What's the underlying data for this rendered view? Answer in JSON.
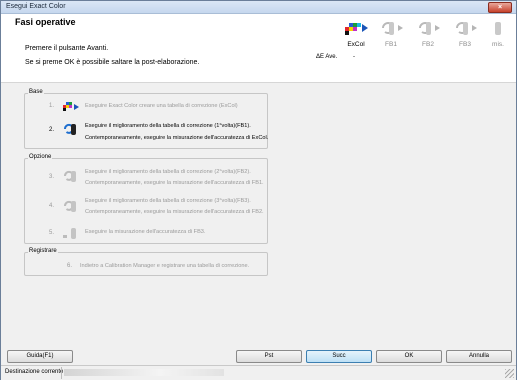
{
  "window": {
    "title": "Esegui Exact Color",
    "close_label": "×"
  },
  "header": {
    "heading": "Fasi operative",
    "line1": "Premere il pulsante Avanti.",
    "line2": "Se si preme OK è possibile saltare la post-elaborazione.",
    "delta_label": "ΔE Ave.",
    "delta_value": "-"
  },
  "steps": [
    {
      "label": "ExCol",
      "active": true
    },
    {
      "label": "FB1",
      "active": false
    },
    {
      "label": "FB2",
      "active": false
    },
    {
      "label": "FB3",
      "active": false
    },
    {
      "label": "mis.",
      "active": false
    }
  ],
  "groups": {
    "base": {
      "title": "Base",
      "items": [
        {
          "num": "1.",
          "line1": "Eseguire Exact Color creare una tabella di correzione (ExCol)",
          "line2": ""
        },
        {
          "num": "2.",
          "line1": "Eseguire il miglioramento della tabella di correzione (1°volta)(FB1).",
          "line2": "Contemporaneamente, eseguire la misurazione dell'accuratezza di ExCol."
        }
      ]
    },
    "opzione": {
      "title": "Opzione",
      "items": [
        {
          "num": "3.",
          "line1": "Eseguire il miglioramento della tabella di correzione (2°volta)(FB2).",
          "line2": "Contemporaneamente, eseguire la misurazione dell'accuratezza di FB1."
        },
        {
          "num": "4.",
          "line1": "Eseguire il miglioramento della tabella di correzione (3°volta)(FB3).",
          "line2": "Contemporaneamente, eseguire la misurazione dell'accuratezza di FB2."
        },
        {
          "num": "5.",
          "line1": "Eseguire la misurazione dell'accuratezza di FB3.",
          "line2": ""
        }
      ]
    },
    "registrare": {
      "title": "Registrare",
      "items": [
        {
          "num": "6.",
          "line1": "Indietro a Calibration Manager e registrare una tabella di correzione."
        }
      ]
    }
  },
  "buttons": {
    "help": "Guida(F1)",
    "prev": "Pst",
    "next": "Succ",
    "ok": "OK",
    "cancel": "Annulla"
  },
  "status": {
    "text": "Destinazione corrente"
  }
}
